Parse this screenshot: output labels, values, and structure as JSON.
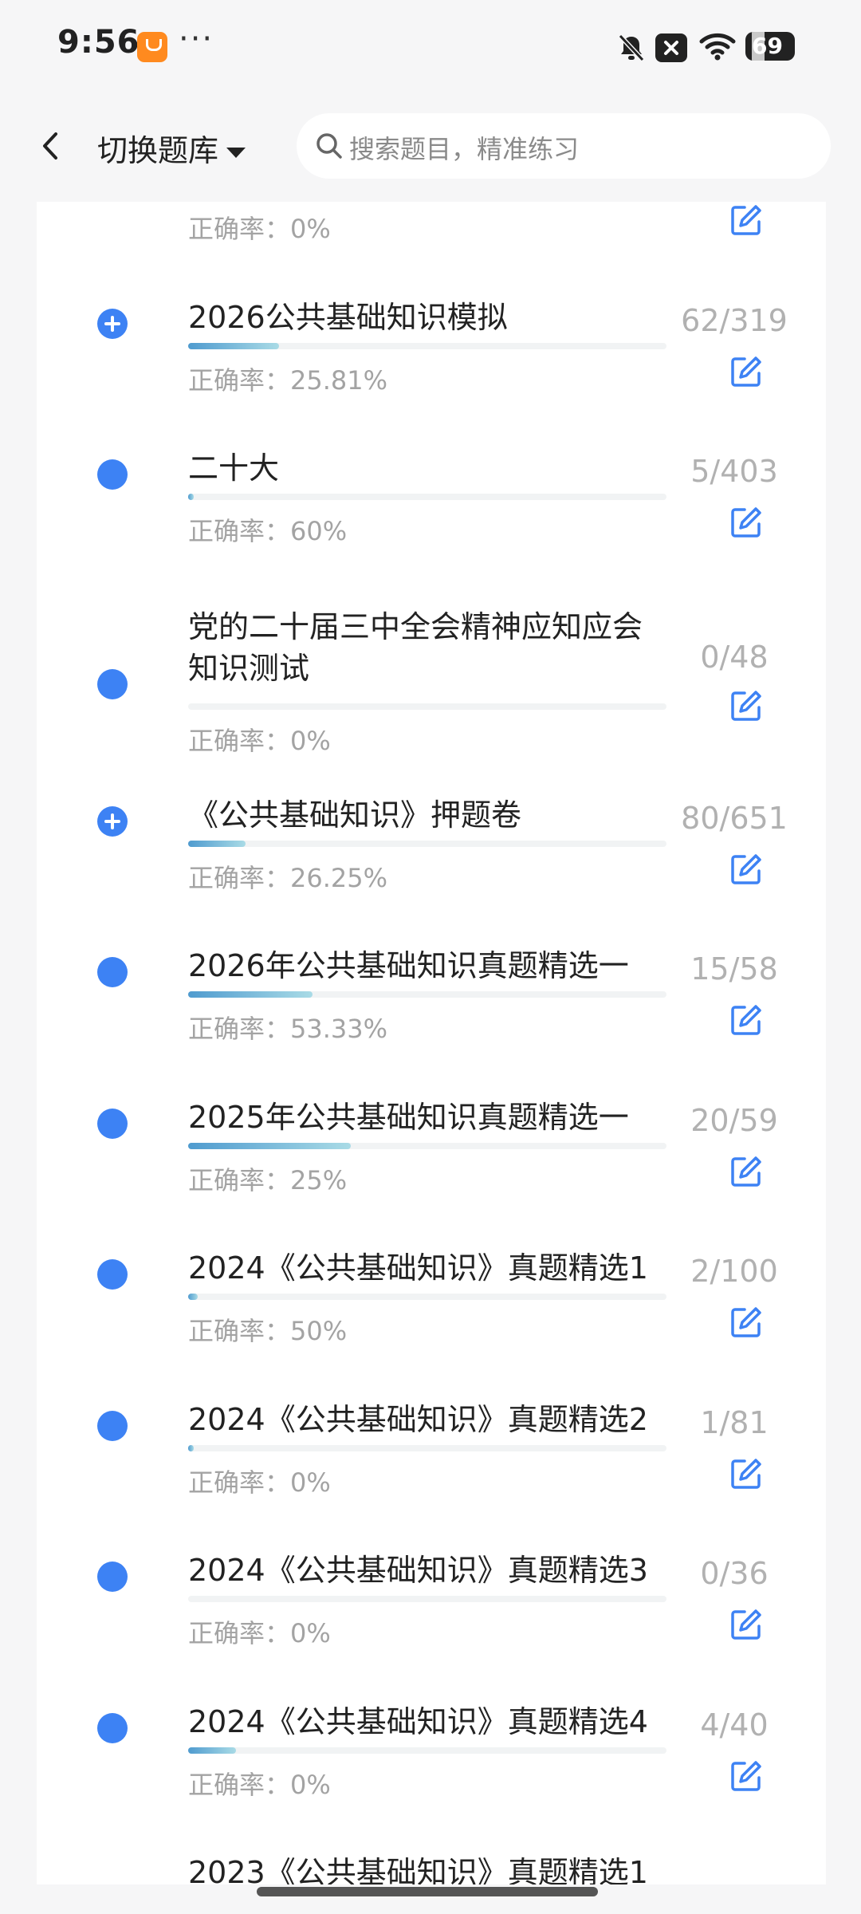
{
  "status_bar": {
    "time": "9:56",
    "more": "···",
    "battery": "69"
  },
  "header": {
    "switch_label": "切换题库",
    "search_placeholder": "搜索题目，精准练习"
  },
  "accuracy_prefix": "正确率：",
  "items": [
    {
      "title": "",
      "count": "",
      "accuracy": "0%",
      "progress": 0,
      "icon": "dot"
    },
    {
      "title": "2026公共基础知识模拟",
      "count": "62/319",
      "accuracy": "25.81%",
      "progress": 0.19,
      "icon": "plus"
    },
    {
      "title": "二十大",
      "count": "5/403",
      "accuracy": "60%",
      "progress": 0.012,
      "icon": "dot"
    },
    {
      "title": "党的二十届三中全会精神应知应会知识测试",
      "count": "0/48",
      "accuracy": "0%",
      "progress": 0,
      "icon": "dot"
    },
    {
      "title": "《公共基础知识》押题卷",
      "count": "80/651",
      "accuracy": "26.25%",
      "progress": 0.12,
      "icon": "plus"
    },
    {
      "title": "2026年公共基础知识真题精选一",
      "count": "15/58",
      "accuracy": "53.33%",
      "progress": 0.26,
      "icon": "dot"
    },
    {
      "title": "2025年公共基础知识真题精选一",
      "count": "20/59",
      "accuracy": "25%",
      "progress": 0.34,
      "icon": "dot"
    },
    {
      "title": "2024《公共基础知识》真题精选1",
      "count": "2/100",
      "accuracy": "50%",
      "progress": 0.02,
      "icon": "dot"
    },
    {
      "title": "2024《公共基础知识》真题精选2",
      "count": "1/81",
      "accuracy": "0%",
      "progress": 0.012,
      "icon": "dot"
    },
    {
      "title": "2024《公共基础知识》真题精选3",
      "count": "0/36",
      "accuracy": "0%",
      "progress": 0,
      "icon": "dot"
    },
    {
      "title": "2024《公共基础知识》真题精选4",
      "count": "4/40",
      "accuracy": "0%",
      "progress": 0.1,
      "icon": "dot"
    },
    {
      "title": "2023《公共基础知识》真题精选1",
      "count": "",
      "accuracy": "",
      "progress": 0,
      "icon": "none"
    }
  ]
}
